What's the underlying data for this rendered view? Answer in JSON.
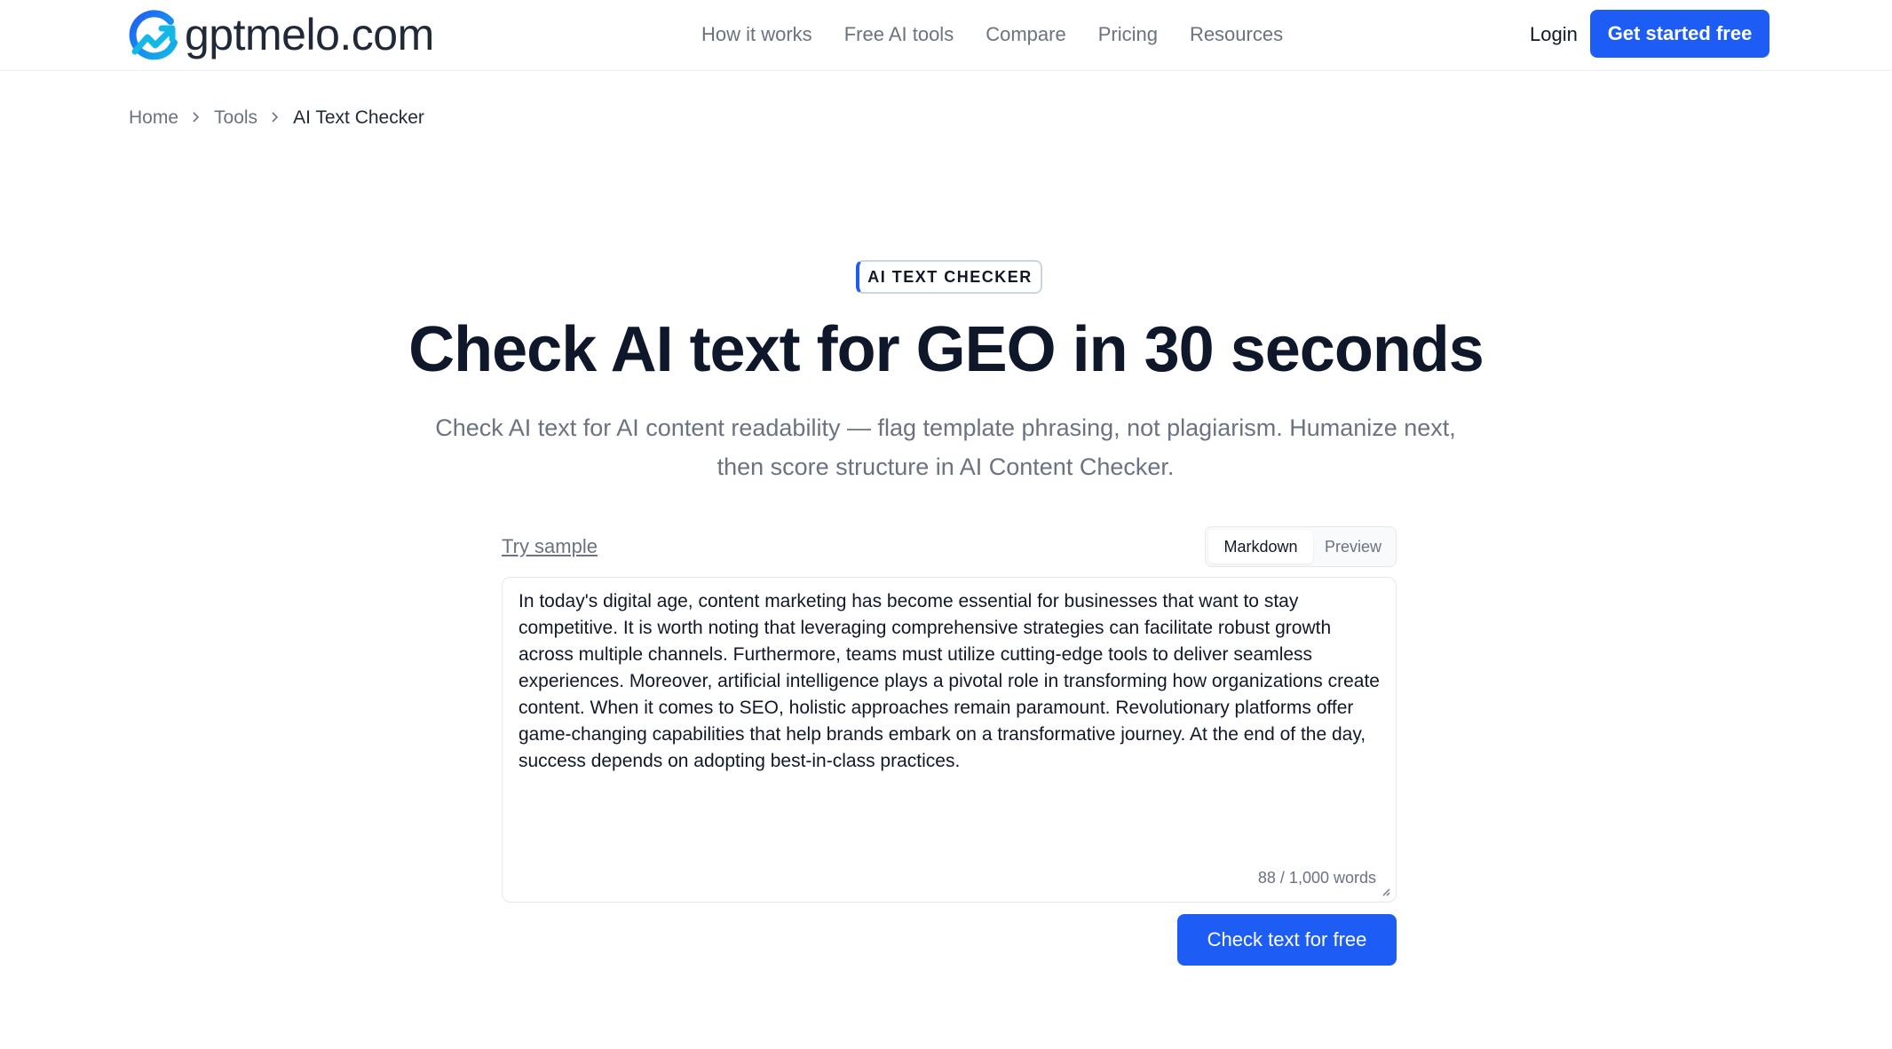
{
  "brand": {
    "name": "gptmelo.com",
    "accent": "#1d5cf5",
    "logo_icon": "g-arrow-logo-icon"
  },
  "nav": {
    "items": [
      {
        "label": "How it works"
      },
      {
        "label": "Free AI tools"
      },
      {
        "label": "Compare"
      },
      {
        "label": "Pricing"
      },
      {
        "label": "Resources"
      }
    ],
    "login": "Login",
    "cta": "Get started free"
  },
  "breadcrumb": {
    "items": [
      "Home",
      "Tools",
      "AI Text Checker"
    ],
    "separator_icon": "chevron-right-icon"
  },
  "hero": {
    "badge": "AI TEXT CHECKER",
    "title": "Check AI text for GEO in 30 seconds",
    "subtitle": "Check AI text for AI content readability — flag template phrasing, not plagiarism. Humanize next, then score structure in AI Content Checker."
  },
  "editor": {
    "try_sample": "Try sample",
    "tabs": [
      "Markdown",
      "Preview"
    ],
    "active_tab": "Markdown",
    "text": "In today's digital age, content marketing has become essential for businesses that want to stay competitive. It is worth noting that leveraging comprehensive strategies can facilitate robust growth across multiple channels. Furthermore, teams must utilize cutting-edge tools to deliver seamless experiences. Moreover, artificial intelligence plays a pivotal role in transforming how organizations create content. When it comes to SEO, holistic approaches remain paramount. Revolutionary platforms offer game-changing capabilities that help brands embark on a transformative journey. At the end of the day, success depends on adopting best-in-class practices.",
    "word_count": "88 / 1,000 words",
    "submit": "Check text for free"
  }
}
